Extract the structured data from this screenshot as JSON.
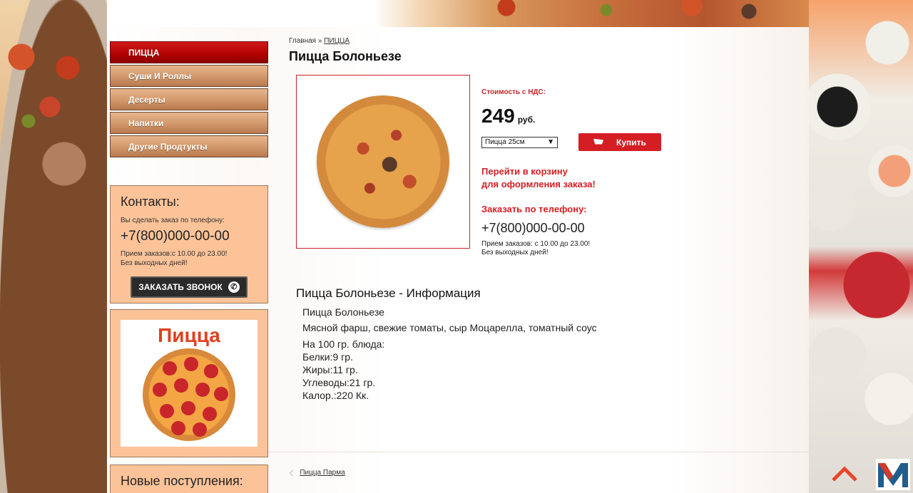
{
  "sidebar": {
    "menu": [
      {
        "label": "ПИЦЦА",
        "active": true
      },
      {
        "label": "Суши И Роллы",
        "active": false
      },
      {
        "label": "Десерты",
        "active": false
      },
      {
        "label": "Напитки",
        "active": false
      },
      {
        "label": "Другие Продтукты",
        "active": false
      }
    ],
    "contacts": {
      "title": "Контакты:",
      "intro": "Вы сделать заказ по телефону:",
      "phone": "+7(800)000-00-00",
      "hours": "Прием заказов:с 10.00 до 23.00!",
      "days": "Без выходных дней!",
      "call_button": "ЗАКАЗАТЬ ЗВОНОК"
    },
    "promo": {
      "title": "Пицца"
    },
    "news": {
      "title": "Новые поступления:"
    }
  },
  "breadcrumb": {
    "home": "Главная",
    "separator": "»",
    "current": "ПИЦЦА"
  },
  "product": {
    "title": "Пицца Болоньезе",
    "price_label": "Стоимость с НДС:",
    "price": "249",
    "currency": "руб.",
    "size_selected": "Пицца 25см",
    "buy_label": "Купить",
    "cart_link": "Перейти в корзину\nдля оформления заказа!",
    "order_label": "Заказать по телефону:",
    "order_phone": "+7(800)000-00-00",
    "order_hours": "Прием заказов: с 10.00 до 23.00!\nБез выходных дней!"
  },
  "info": {
    "heading": "Пицца Болоньезе - Информация",
    "name": "Пицца Болоньезе",
    "ingredients": "Мясной фарш, свежие томаты, сыр Моцарелла, томатный соус",
    "per100": "На 100 гр. блюда:",
    "protein": "Белки:9 гр.",
    "fat": "Жиры:11 гр.",
    "carbs": "Углеводы:21 гр.",
    "calories": "Калор.:220 Кк."
  },
  "nav": {
    "prev": "Пицца Парма"
  },
  "colors": {
    "accent": "#d41e24",
    "menu_active": "#b00000",
    "menu": "#d39a6d",
    "sidebar_box": "#fcc399"
  },
  "icons": {
    "cart": "cart-icon",
    "phone": "phone-icon",
    "up": "up-arrow-icon",
    "logo": "logo-m-icon"
  }
}
